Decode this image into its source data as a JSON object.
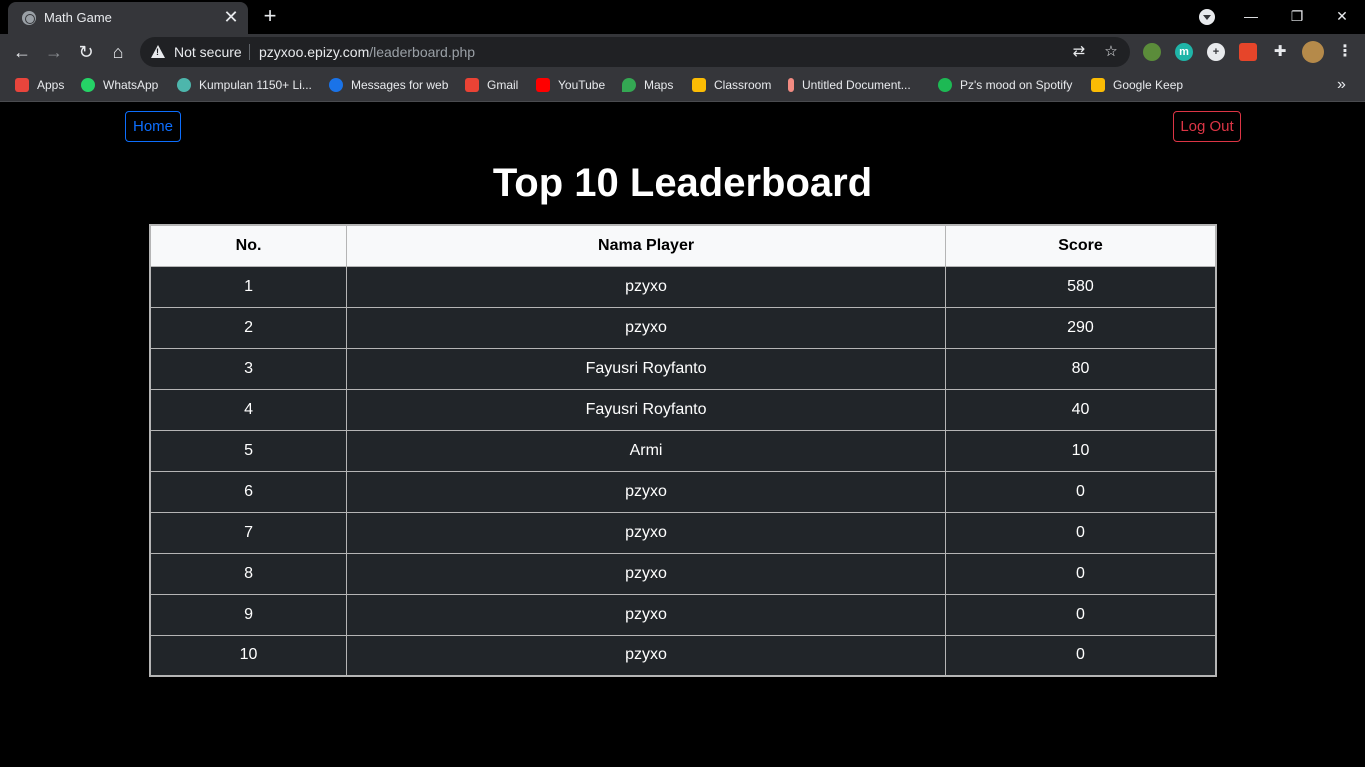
{
  "browser": {
    "tab_title": "Math Game",
    "tab_close": "✕",
    "new_tab": "+",
    "security_label": "Not secure",
    "url_domain": "pzyxoo.epizy.com",
    "url_path": "/leaderboard.php",
    "window_controls": {
      "minimize": "—",
      "restore": "❐",
      "close": "✕"
    }
  },
  "bookmarks": [
    {
      "label": "Apps",
      "icon": "apps-grid-icon",
      "color": "#e8453c"
    },
    {
      "label": "WhatsApp",
      "icon": "whatsapp-icon",
      "color": "#25d366"
    },
    {
      "label": "Kumpulan 1150+ Li...",
      "icon": "bookmark-site-icon",
      "color": "#4db6ac"
    },
    {
      "label": "Messages for web",
      "icon": "messages-icon",
      "color": "#1a73e8"
    },
    {
      "label": "Gmail",
      "icon": "gmail-icon",
      "color": "#ea4335"
    },
    {
      "label": "YouTube",
      "icon": "youtube-icon",
      "color": "#ff0000"
    },
    {
      "label": "Maps",
      "icon": "maps-icon",
      "color": "#34a853"
    },
    {
      "label": "Classroom",
      "icon": "classroom-icon",
      "color": "#fbbc04"
    },
    {
      "label": "Untitled Document...",
      "icon": "document-icon",
      "color": "#f28b82"
    },
    {
      "label": "Pz's mood on Spotify",
      "icon": "spotify-icon",
      "color": "#1db954"
    },
    {
      "label": "Google Keep",
      "icon": "keep-icon",
      "color": "#fbbc04"
    }
  ],
  "bookmarks_more": "»",
  "page": {
    "home_label": "Home",
    "logout_label": "Log Out",
    "title": "Top 10 Leaderboard",
    "colors": {
      "home": "#0d6efd",
      "logout": "#dc3545",
      "header_bg": "#f8f9fa",
      "row_bg": "#212529"
    }
  },
  "leaderboard": {
    "headers": [
      "No.",
      "Nama Player",
      "Score"
    ],
    "rows": [
      {
        "no": "1",
        "name": "pzyxo",
        "score": "580"
      },
      {
        "no": "2",
        "name": "pzyxo",
        "score": "290"
      },
      {
        "no": "3",
        "name": "Fayusri Royfanto",
        "score": "80"
      },
      {
        "no": "4",
        "name": "Fayusri Royfanto",
        "score": "40"
      },
      {
        "no": "5",
        "name": "Armi",
        "score": "10"
      },
      {
        "no": "6",
        "name": "pzyxo",
        "score": "0"
      },
      {
        "no": "7",
        "name": "pzyxo",
        "score": "0"
      },
      {
        "no": "8",
        "name": "pzyxo",
        "score": "0"
      },
      {
        "no": "9",
        "name": "pzyxo",
        "score": "0"
      },
      {
        "no": "10",
        "name": "pzyxo",
        "score": "0"
      }
    ]
  }
}
